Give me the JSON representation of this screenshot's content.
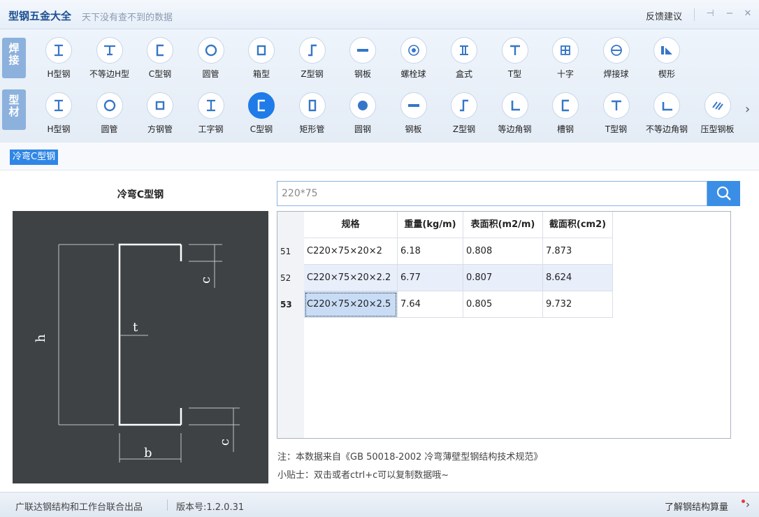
{
  "titlebar": {
    "title": "型钢五金大全",
    "subtitle": "天下没有查不到的数据",
    "feedback": "反馈建议"
  },
  "categories": {
    "weld": "焊接",
    "profile": "型材"
  },
  "weld_items": [
    {
      "label": "H型钢",
      "icon": "h-beam-icon"
    },
    {
      "label": "不等边H型",
      "icon": "unequal-h-icon"
    },
    {
      "label": "C型钢",
      "icon": "c-channel-icon"
    },
    {
      "label": "圆管",
      "icon": "round-pipe-icon"
    },
    {
      "label": "箱型",
      "icon": "box-section-icon"
    },
    {
      "label": "Z型钢",
      "icon": "z-section-icon"
    },
    {
      "label": "钢板",
      "icon": "plate-icon"
    },
    {
      "label": "螺栓球",
      "icon": "bolt-ball-icon"
    },
    {
      "label": "盒式",
      "icon": "box-type-icon"
    },
    {
      "label": "T型",
      "icon": "t-section-icon"
    },
    {
      "label": "十字",
      "icon": "cross-section-icon"
    },
    {
      "label": "焊接球",
      "icon": "weld-ball-icon"
    },
    {
      "label": "楔形",
      "icon": "wedge-icon"
    }
  ],
  "profile_items": [
    {
      "label": "H型钢",
      "icon": "h-beam-icon"
    },
    {
      "label": "圆管",
      "icon": "round-pipe-icon"
    },
    {
      "label": "方钢管",
      "icon": "square-pipe-icon"
    },
    {
      "label": "工字钢",
      "icon": "i-beam-icon"
    },
    {
      "label": "C型钢",
      "icon": "c-channel-icon"
    },
    {
      "label": "矩形管",
      "icon": "rect-pipe-icon"
    },
    {
      "label": "圆钢",
      "icon": "round-bar-icon"
    },
    {
      "label": "钢板",
      "icon": "plate-icon"
    },
    {
      "label": "Z型钢",
      "icon": "z-section-icon"
    },
    {
      "label": "等边角钢",
      "icon": "equal-angle-icon"
    },
    {
      "label": "槽钢",
      "icon": "channel-icon"
    },
    {
      "label": "T型钢",
      "icon": "t-section-icon"
    },
    {
      "label": "不等边角钢",
      "icon": "unequal-angle-icon"
    },
    {
      "label": "压型钢板",
      "icon": "deck-plate-icon"
    }
  ],
  "breadcrumb": "冷弯C型钢",
  "panel": {
    "title": "冷弯C型钢",
    "dims": {
      "h": "h",
      "b": "b",
      "t": "t",
      "c": "c"
    }
  },
  "search": {
    "value": "220*75"
  },
  "table": {
    "headers": [
      "规格",
      "重量(kg/m)",
      "表面积(m2/m)",
      "截面积(cm2)"
    ],
    "rows": [
      {
        "n": "51",
        "spec": "C220×75×20×2",
        "weight": "6.18",
        "area_surf": "0.808",
        "area_sec": "7.873"
      },
      {
        "n": "52",
        "spec": "C220×75×20×2.2",
        "weight": "6.77",
        "area_surf": "0.807",
        "area_sec": "8.624"
      },
      {
        "n": "53",
        "spec": "C220×75×20×2.5",
        "weight": "7.64",
        "area_surf": "0.805",
        "area_sec": "9.732"
      }
    ]
  },
  "note": "注：本数据来自《GB  50018-2002  冷弯薄壁型钢结构技术规范》",
  "tip": "小贴士：双击或者ctrl+c可以复制数据哦~",
  "statusbar": {
    "left": "广联达钢结构和工作台联合出品",
    "version": "版本号:1.2.0.31",
    "right": "了解钢结构算量"
  },
  "colors": {
    "accent": "#1f7be8",
    "icon_stroke": "#3576c8",
    "diagram_bg": "#3f4245"
  }
}
